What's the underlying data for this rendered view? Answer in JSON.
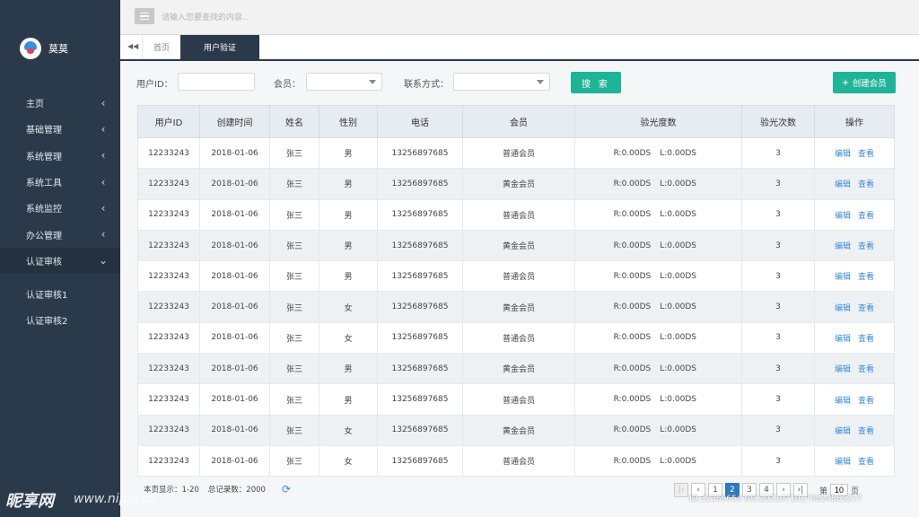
{
  "user": {
    "name": "莫莫"
  },
  "topbar": {
    "search_placeholder": "请输入您要查找的内容..."
  },
  "tabs": {
    "home": "首页",
    "active": "用户验证"
  },
  "sidebar": {
    "items": [
      {
        "label": "主页"
      },
      {
        "label": "基础管理"
      },
      {
        "label": "系统管理"
      },
      {
        "label": "系统工具"
      },
      {
        "label": "系统监控"
      },
      {
        "label": "办公管理"
      },
      {
        "label": "认证审核"
      }
    ],
    "subitems": [
      {
        "label": "认证审核1"
      },
      {
        "label": "认证审核2"
      }
    ]
  },
  "filters": {
    "user_id_label": "用户ID：",
    "member_label": "会员：",
    "contact_label": "联系方式：",
    "search_button": "搜 索",
    "create_button": "创建会员"
  },
  "table": {
    "headers": [
      "用户ID",
      "创建时间",
      "姓名",
      "性别",
      "电话",
      "会员",
      "验光度数",
      "验光次数",
      "操作"
    ],
    "op_edit": "编辑",
    "op_view": "查看",
    "rows": [
      {
        "id": "12233243",
        "date": "2018-01-06",
        "name": "张三",
        "gender": "男",
        "phone": "13256897685",
        "member": "普通会员",
        "r": "R:0.00DS",
        "l": "L:0.00DS",
        "count": "3"
      },
      {
        "id": "12233243",
        "date": "2018-01-06",
        "name": "张三",
        "gender": "男",
        "phone": "13256897685",
        "member": "黄金会员",
        "r": "R:0.00DS",
        "l": "L:0.00DS",
        "count": "3"
      },
      {
        "id": "12233243",
        "date": "2018-01-06",
        "name": "张三",
        "gender": "男",
        "phone": "13256897685",
        "member": "普通会员",
        "r": "R:0.00DS",
        "l": "L:0.00DS",
        "count": "3"
      },
      {
        "id": "12233243",
        "date": "2018-01-06",
        "name": "张三",
        "gender": "男",
        "phone": "13256897685",
        "member": "黄金会员",
        "r": "R:0.00DS",
        "l": "L:0.00DS",
        "count": "3"
      },
      {
        "id": "12233243",
        "date": "2018-01-06",
        "name": "张三",
        "gender": "男",
        "phone": "13256897685",
        "member": "普通会员",
        "r": "R:0.00DS",
        "l": "L:0.00DS",
        "count": "3"
      },
      {
        "id": "12233243",
        "date": "2018-01-06",
        "name": "张三",
        "gender": "女",
        "phone": "13256897685",
        "member": "黄金会员",
        "r": "R:0.00DS",
        "l": "L:0.00DS",
        "count": "3"
      },
      {
        "id": "12233243",
        "date": "2018-01-06",
        "name": "张三",
        "gender": "女",
        "phone": "13256897685",
        "member": "普通会员",
        "r": "R:0.00DS",
        "l": "L:0.00DS",
        "count": "3"
      },
      {
        "id": "12233243",
        "date": "2018-01-06",
        "name": "张三",
        "gender": "男",
        "phone": "13256897685",
        "member": "黄金会员",
        "r": "R:0.00DS",
        "l": "L:0.00DS",
        "count": "3"
      },
      {
        "id": "12233243",
        "date": "2018-01-06",
        "name": "张三",
        "gender": "男",
        "phone": "13256897685",
        "member": "普通会员",
        "r": "R:0.00DS",
        "l": "L:0.00DS",
        "count": "3"
      },
      {
        "id": "12233243",
        "date": "2018-01-06",
        "name": "张三",
        "gender": "女",
        "phone": "13256897685",
        "member": "黄金会员",
        "r": "R:0.00DS",
        "l": "L:0.00DS",
        "count": "3"
      },
      {
        "id": "12233243",
        "date": "2018-01-06",
        "name": "张三",
        "gender": "女",
        "phone": "13256897685",
        "member": "普通会员",
        "r": "R:0.00DS",
        "l": "L:0.00DS",
        "count": "3"
      }
    ]
  },
  "footer": {
    "page_range": "本页显示：1-20",
    "total": "总记录数：2000",
    "pages": [
      "1",
      "2",
      "3",
      "4"
    ],
    "current_page": "2",
    "goto_prefix": "第",
    "goto_value": "10",
    "goto_suffix": "页"
  },
  "watermark": {
    "brand": "昵享网",
    "site": "www.nipic.cn",
    "id": "ID:32369654 NO:20210710173824885277"
  }
}
